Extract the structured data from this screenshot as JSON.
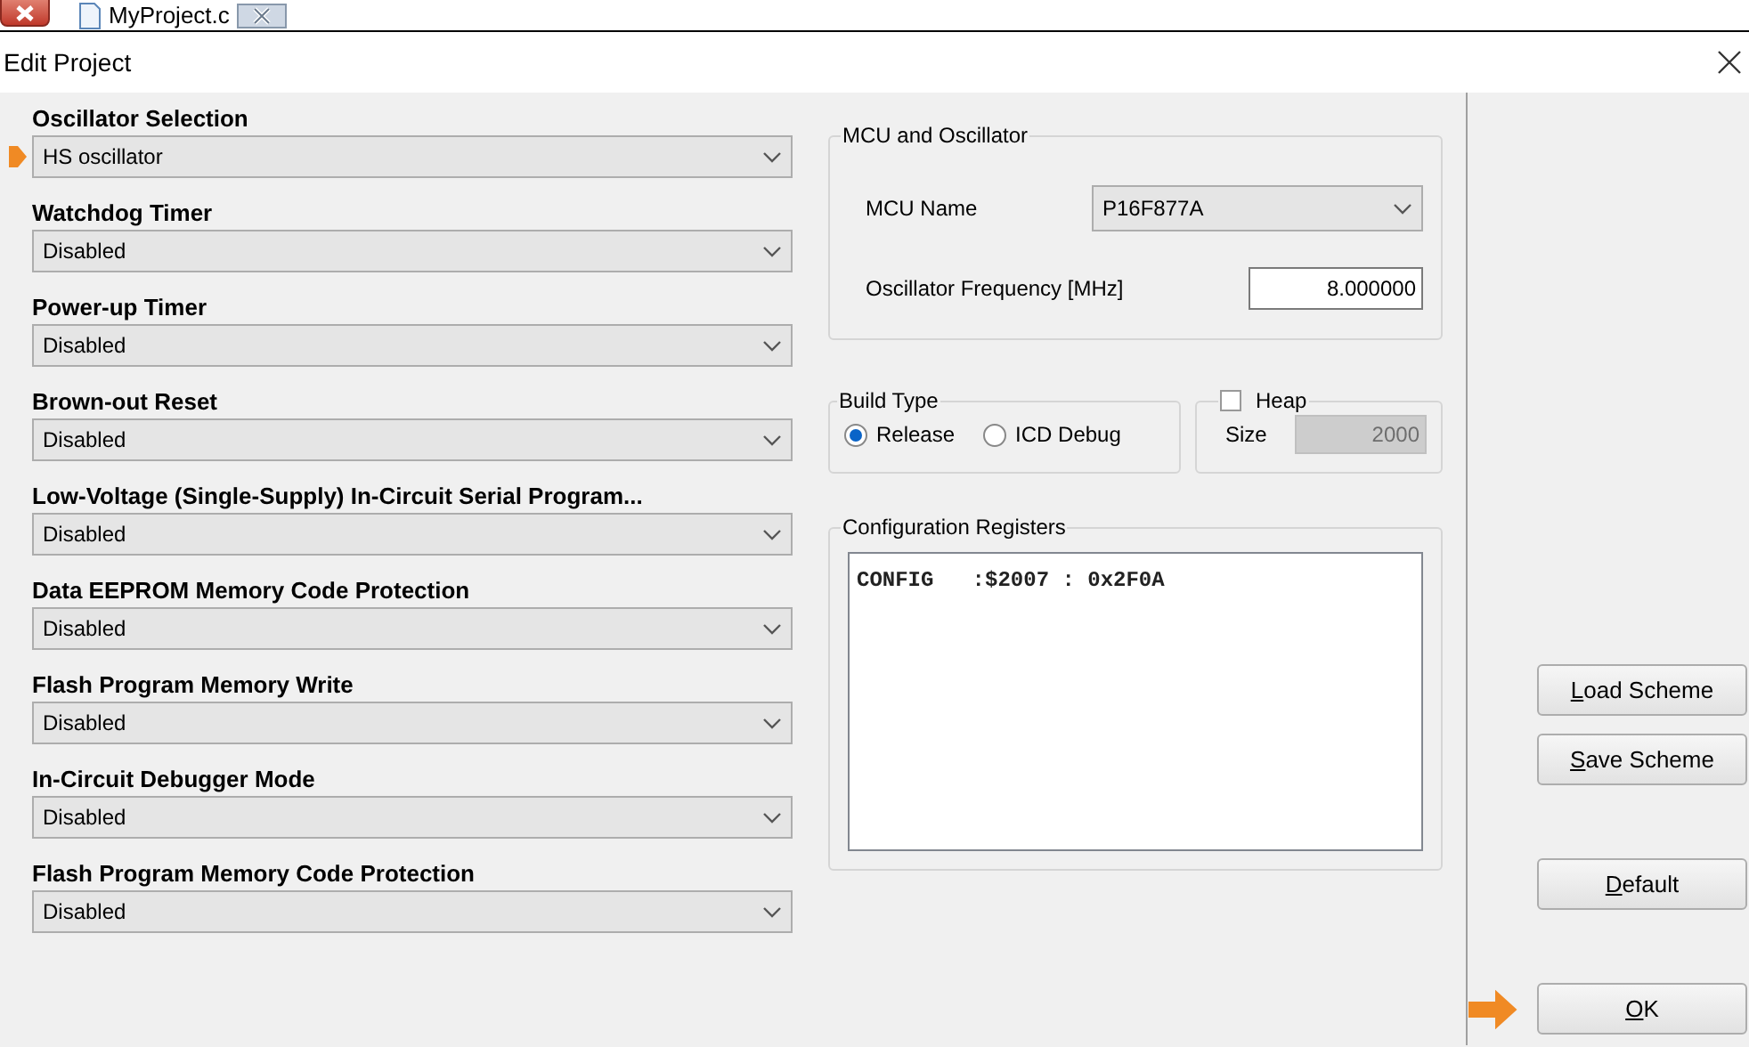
{
  "editor_tabs": [
    {
      "label": "MyProject.c"
    }
  ],
  "window": {
    "title": "Edit Project"
  },
  "config_bits": [
    {
      "label": "Oscillator Selection",
      "value": "HS oscillator"
    },
    {
      "label": "Watchdog Timer",
      "value": "Disabled"
    },
    {
      "label": "Power-up Timer",
      "value": "Disabled"
    },
    {
      "label": "Brown-out Reset",
      "value": "Disabled"
    },
    {
      "label": "Low-Voltage (Single-Supply) In-Circuit Serial Program...",
      "value": "Disabled"
    },
    {
      "label": "Data EEPROM Memory Code Protection",
      "value": "Disabled"
    },
    {
      "label": "Flash Program Memory Write",
      "value": "Disabled"
    },
    {
      "label": "In-Circuit Debugger Mode",
      "value": "Disabled"
    },
    {
      "label": "Flash Program Memory Code Protection",
      "value": "Disabled"
    }
  ],
  "mcu_group": {
    "title": "MCU and Oscillator",
    "mcu_label": "MCU Name",
    "mcu_value": "P16F877A",
    "freq_label": "Oscillator Frequency [MHz]",
    "freq_value": "8.000000"
  },
  "build_type": {
    "title": "Build Type",
    "options": [
      {
        "label": "Release",
        "selected": true
      },
      {
        "label": "ICD Debug",
        "selected": false
      }
    ]
  },
  "heap": {
    "title": "Heap",
    "checked": false,
    "size_label": "Size",
    "size_value": "2000",
    "disabled": true
  },
  "config_registers": {
    "title": "Configuration Registers",
    "text": "CONFIG   :$2007 : 0x2F0A"
  },
  "buttons": [
    {
      "label": "Load Scheme",
      "first_letter_underlined": true
    },
    {
      "label": "Save Scheme",
      "first_letter_underlined": true
    },
    {
      "label": "Default",
      "first_letter_underlined": true
    },
    {
      "label": "OK",
      "first_letter_underlined": true
    }
  ]
}
